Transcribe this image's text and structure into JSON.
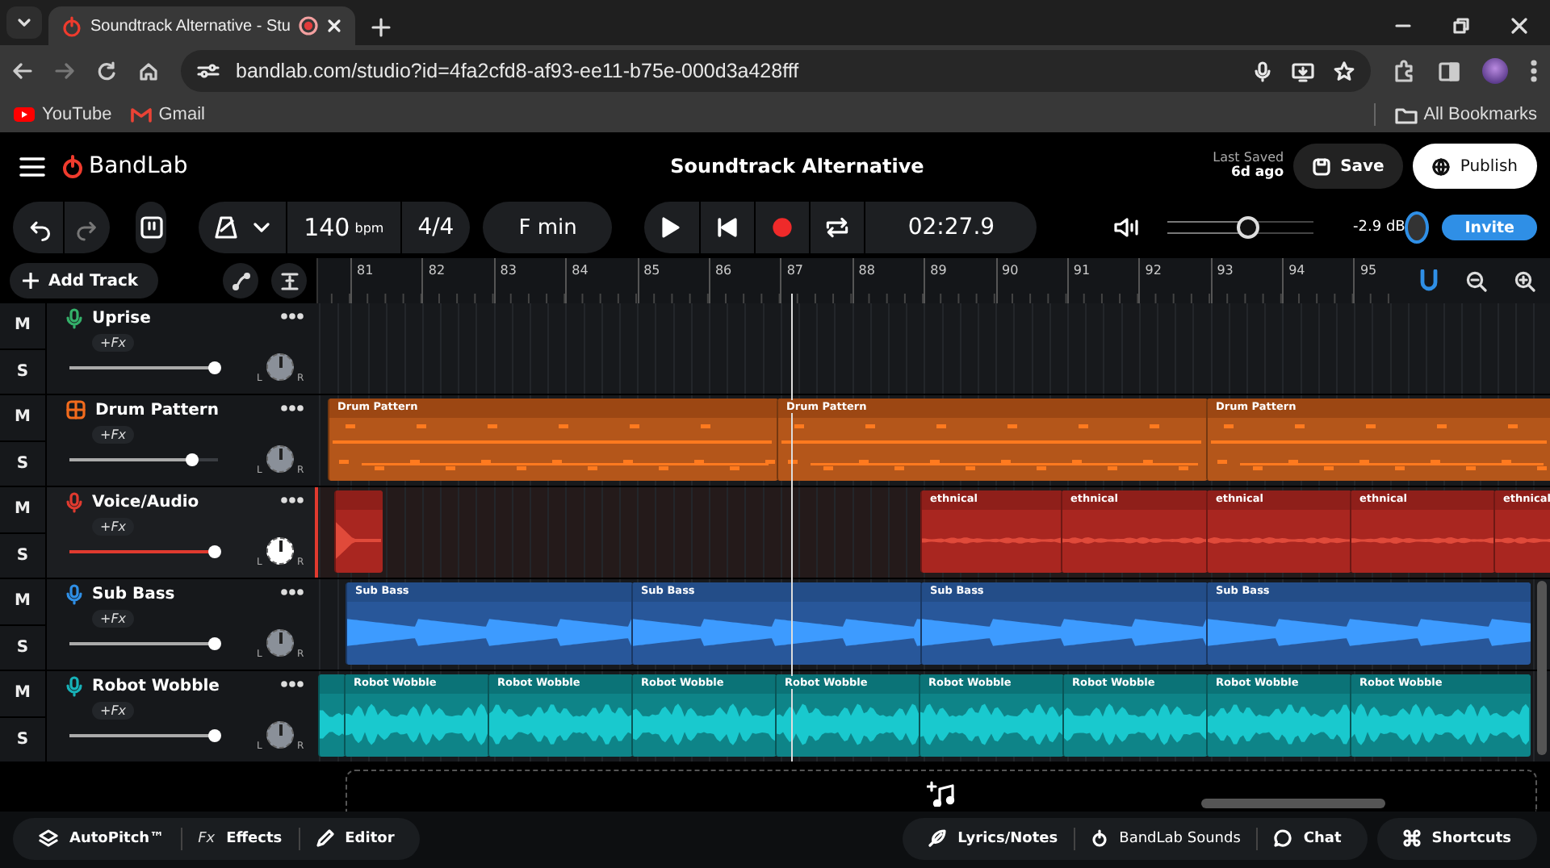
{
  "browser": {
    "tabs": [
      {
        "title": "Soundtrack Alternative - Stu",
        "selected": true
      }
    ],
    "url": "bandlab.com/studio?id=4fa2cfd8-af93-ee11-b75e-000d3a428fff",
    "bookmarks": [
      {
        "label": "YouTube",
        "kind": "youtube"
      },
      {
        "label": "Gmail",
        "kind": "gmail"
      }
    ],
    "all_bookmarks": "All Bookmarks"
  },
  "app": {
    "logo": "BandLab",
    "title": "Soundtrack Alternative",
    "last_saved_label": "Last Saved",
    "last_saved_value": "6d ago",
    "save": "Save",
    "publish": "Publish"
  },
  "toolbar": {
    "tempo": "140",
    "tempo_unit": "bpm",
    "time_signature": "4/4",
    "key": "F min",
    "time": "02:27.9",
    "volume": {
      "level": 0.55,
      "reading": "-2.9 dB"
    },
    "invite": "Invite"
  },
  "add_track": "Add Track",
  "ruler": [
    "81",
    "82",
    "83",
    "84",
    "85",
    "86",
    "87",
    "88",
    "89",
    "90",
    "91",
    "92",
    "93",
    "94",
    "95"
  ],
  "tracks": [
    {
      "name": "Uprise",
      "kind": "mic",
      "color": "#34b06a",
      "selected": false,
      "mute": "M",
      "solo": "S",
      "fx": "+Fx",
      "volume": {
        "level": 0.98
      },
      "pan_left": "L",
      "pan_right": "R"
    },
    {
      "name": "Drum Pattern",
      "kind": "drums",
      "color": "#f26b1d",
      "selected": false,
      "mute": "M",
      "solo": "S",
      "fx": "+Fx",
      "volume": {
        "level": 0.83
      },
      "pan_left": "L",
      "pan_right": "R",
      "clips": [
        {
          "kind": "pattern",
          "label": "Drum Pattern"
        },
        {
          "kind": "pattern",
          "label": "Drum Pattern"
        },
        {
          "kind": "pattern",
          "label": "Drum Pattern"
        }
      ]
    },
    {
      "name": "Voice/Audio",
      "kind": "mic",
      "color": "#e03a2f",
      "selected": true,
      "mute": "M",
      "solo": "S",
      "fx": "+Fx",
      "volume": {
        "level": 0.98
      },
      "pan_left": "L",
      "pan_right": "R",
      "clips": [
        {
          "kind": "audio"
        },
        {
          "kind": "audio",
          "label": "ethnical"
        },
        {
          "kind": "audio",
          "label": "ethnical"
        },
        {
          "kind": "audio",
          "label": "ethnical"
        },
        {
          "kind": "audio",
          "label": "ethnical"
        },
        {
          "kind": "audio",
          "label": "ethnical"
        }
      ]
    },
    {
      "name": "Sub Bass",
      "kind": "mic",
      "color": "#2f8fe6",
      "selected": false,
      "mute": "M",
      "solo": "S",
      "fx": "+Fx",
      "volume": {
        "level": 0.98
      },
      "pan_left": "L",
      "pan_right": "R",
      "clips": [
        {
          "kind": "audio",
          "label": "Sub Bass"
        },
        {
          "kind": "audio",
          "label": "Sub Bass"
        },
        {
          "kind": "audio",
          "label": "Sub Bass"
        },
        {
          "kind": "audio",
          "label": "Sub Bass"
        }
      ]
    },
    {
      "name": "Robot Wobble",
      "kind": "mic",
      "color": "#17b2b8",
      "selected": false,
      "mute": "M",
      "solo": "S",
      "fx": "+Fx",
      "volume": {
        "level": 0.98
      },
      "pan_left": "L",
      "pan_right": "R",
      "clips": [
        {
          "kind": "audio"
        },
        {
          "kind": "audio",
          "label": "Robot Wobble"
        },
        {
          "kind": "audio",
          "label": "Robot Wobble"
        },
        {
          "kind": "audio",
          "label": "Robot Wobble"
        },
        {
          "kind": "audio",
          "label": "Robot Wobble"
        },
        {
          "kind": "audio",
          "label": "Robot Wobble"
        },
        {
          "kind": "audio",
          "label": "Robot Wobble"
        },
        {
          "kind": "audio",
          "label": "Robot Wobble"
        },
        {
          "kind": "audio",
          "label": "Robot Wobble"
        }
      ]
    }
  ],
  "bottom_bar": {
    "left": [
      {
        "kind": "autopitch",
        "label": "AutoPitch™"
      },
      {
        "kind": "effects",
        "icon_text": "Fx",
        "label": "Effects"
      },
      {
        "kind": "editor",
        "label": "Editor"
      }
    ],
    "right": [
      {
        "kind": "lyrics",
        "label": "Lyrics/Notes"
      },
      {
        "kind": "sounds",
        "label": "BandLab Sounds"
      },
      {
        "kind": "chat",
        "label": "Chat"
      },
      {
        "kind": "shortcuts",
        "label": "Shortcuts"
      }
    ]
  }
}
